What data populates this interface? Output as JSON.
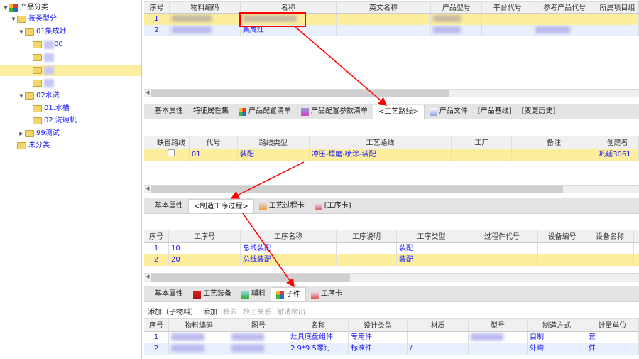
{
  "tree": [
    {
      "label": "产品分类",
      "level": 0,
      "expanded": true,
      "icon": "root"
    },
    {
      "label": "按类型分",
      "level": 1,
      "expanded": true
    },
    {
      "label": "01集成灶",
      "level": 2,
      "expanded": true
    },
    {
      "label": "00",
      "level": 3,
      "blurred": true
    },
    {
      "label": "",
      "level": 3,
      "blurred": true
    },
    {
      "label": "",
      "level": 3,
      "blurred": true,
      "selected": true
    },
    {
      "label": "",
      "level": 3,
      "blurred": true
    },
    {
      "label": "02水洗",
      "level": 2,
      "expanded": true
    },
    {
      "label": "01.水槽",
      "level": 3
    },
    {
      "label": "02.洗碗机",
      "level": 3
    },
    {
      "label": "99测试",
      "level": 2,
      "collapsed": true
    },
    {
      "label": "未分类",
      "level": 1
    }
  ],
  "grid1": {
    "headers": [
      "序号",
      "物料编码",
      "名称",
      "英文名称",
      "产品型号",
      "平台代号",
      "参考产品代号",
      "所属项目组"
    ],
    "rows": [
      [
        "1",
        null,
        null,
        "",
        null,
        "",
        "",
        ""
      ],
      [
        "2",
        null,
        "集成灶",
        "",
        null,
        "",
        null,
        ""
      ]
    ]
  },
  "tabs1": [
    {
      "label": "基本属性"
    },
    {
      "label": "特征属性集"
    },
    {
      "label": "产品配置清单",
      "icon": "config-list-icon"
    },
    {
      "label": "产品配置参数清单",
      "icon": "param-list-icon"
    },
    {
      "label": "<工艺路线>",
      "active": true
    },
    {
      "label": "产品文件",
      "icon": "file-icon"
    },
    {
      "label": "[产品基线]"
    },
    {
      "label": "[变更历史]"
    }
  ],
  "grid2": {
    "headers": [
      "",
      "缺省路线",
      "代号",
      "路线类型",
      "工艺路线",
      "工厂",
      "备注",
      "创建者"
    ],
    "rows": [
      [
        "",
        "☐",
        "01",
        "装配",
        "冲压-焊磨-喷涂-装配",
        "",
        "",
        "巩廷3061"
      ]
    ]
  },
  "tabs2": [
    {
      "label": "基本属性"
    },
    {
      "label": "<制造工序过程>",
      "active": true
    },
    {
      "label": "工艺过程卡",
      "icon": "process-card-icon"
    },
    {
      "label": "[工序卡]",
      "icon": "operation-card-icon"
    }
  ],
  "grid3": {
    "headers": [
      "序号",
      "工序号",
      "工序名称",
      "工序说明",
      "工序类型",
      "过程件代号",
      "设备编号",
      "设备名称"
    ],
    "rows": [
      [
        "1",
        "10",
        "总线装配",
        "",
        "装配",
        "",
        "",
        ""
      ],
      [
        "2",
        "20",
        "总线装配",
        "",
        "装配",
        "",
        "",
        ""
      ]
    ]
  },
  "tabs3": [
    {
      "label": "基本属性"
    },
    {
      "label": "工艺装备",
      "icon": "magnet-icon"
    },
    {
      "label": "辅料",
      "icon": "bottle-icon"
    },
    {
      "label": "子件",
      "icon": "subpart-icon",
      "active": true
    },
    {
      "label": "工序卡",
      "icon": "operation-card-icon"
    }
  ],
  "toolbar": {
    "add_child": "添加（子物料）",
    "add": "添加",
    "remove": "移去",
    "checkout": "检出关系",
    "cancel_checkout": "撤消检出"
  },
  "grid4": {
    "headers": [
      "序号",
      "物料编码",
      "图号",
      "名称",
      "设计类型",
      "材质",
      "型号",
      "制造方式",
      "计量单位"
    ],
    "rows": [
      [
        "1",
        null,
        null,
        "灶具底盘组件",
        "专用件",
        "",
        null,
        "自制",
        "套"
      ],
      [
        "2",
        null,
        null,
        "2.9*9.5螺钉",
        "标准件",
        "/",
        "",
        "外购",
        "件"
      ]
    ]
  },
  "colors": {
    "selected_row": "#fcee9c",
    "alt_row": "#e8f0fe",
    "link": "#1a1aff",
    "annotation": "#ff0000"
  }
}
